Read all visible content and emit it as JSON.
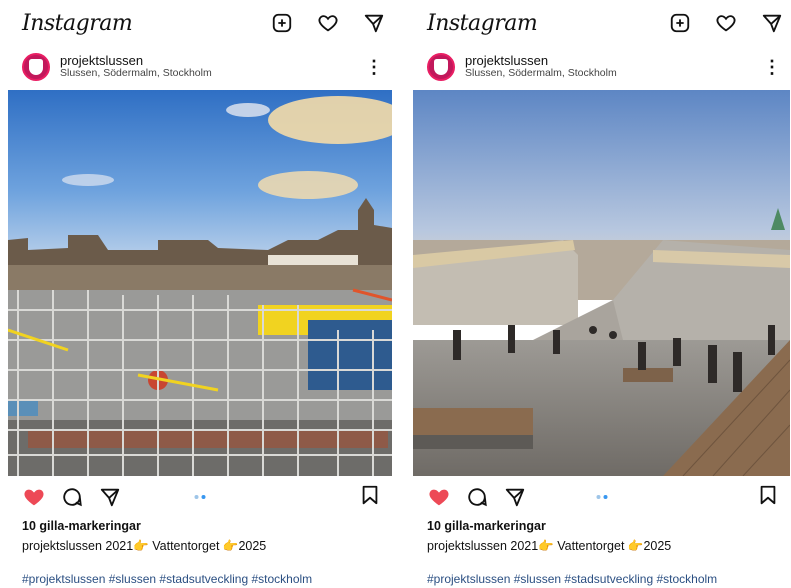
{
  "posts": [
    {
      "app_title": "Instagram",
      "username": "projektslussen",
      "location": "Slussen, Södermalm, Stockholm",
      "more_glyph": "⋮",
      "likes": "10 gilla-markeringar",
      "caption_user": "projektslussen",
      "caption_text": "2021👉 Vattentorget 👉2025",
      "hashtags": "#projektslussen #slussen #stadsutveckling #stockholm",
      "photo_desc": "construction-site"
    },
    {
      "app_title": "Instagram",
      "username": "projektslussen",
      "location": "Slussen, Södermalm, Stockholm",
      "more_glyph": "⋮",
      "likes": "10 gilla-markeringar",
      "caption_user": "projektslussen",
      "caption_text": "2021👉 Vattentorget 👉2025",
      "hashtags": "#projektslussen #slussen #stadsutveckling #stockholm",
      "photo_desc": "rendering-square"
    }
  ],
  "colors": {
    "like_red": "#ed4956",
    "brand_avatar": "#c2185b",
    "hashtag": "#2b4f82",
    "carousel_active": "#3897f0"
  },
  "icons": [
    "new-post-icon",
    "heart-icon",
    "send-icon",
    "comment-icon",
    "bookmark-icon",
    "more-icon"
  ]
}
